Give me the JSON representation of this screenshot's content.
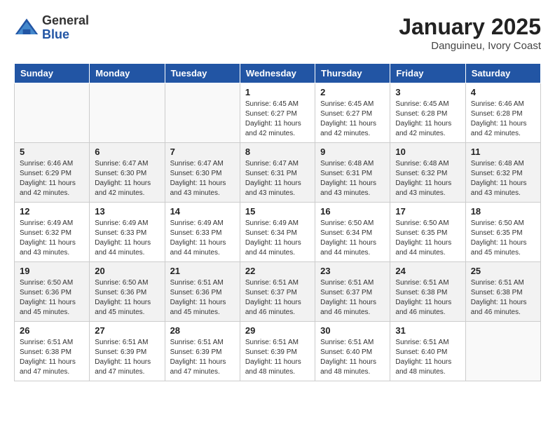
{
  "logo": {
    "general": "General",
    "blue": "Blue"
  },
  "title": "January 2025",
  "location": "Danguineu, Ivory Coast",
  "weekdays": [
    "Sunday",
    "Monday",
    "Tuesday",
    "Wednesday",
    "Thursday",
    "Friday",
    "Saturday"
  ],
  "weeks": [
    [
      {
        "day": "",
        "info": ""
      },
      {
        "day": "",
        "info": ""
      },
      {
        "day": "",
        "info": ""
      },
      {
        "day": "1",
        "info": "Sunrise: 6:45 AM\nSunset: 6:27 PM\nDaylight: 11 hours and 42 minutes."
      },
      {
        "day": "2",
        "info": "Sunrise: 6:45 AM\nSunset: 6:27 PM\nDaylight: 11 hours and 42 minutes."
      },
      {
        "day": "3",
        "info": "Sunrise: 6:45 AM\nSunset: 6:28 PM\nDaylight: 11 hours and 42 minutes."
      },
      {
        "day": "4",
        "info": "Sunrise: 6:46 AM\nSunset: 6:28 PM\nDaylight: 11 hours and 42 minutes."
      }
    ],
    [
      {
        "day": "5",
        "info": "Sunrise: 6:46 AM\nSunset: 6:29 PM\nDaylight: 11 hours and 42 minutes."
      },
      {
        "day": "6",
        "info": "Sunrise: 6:47 AM\nSunset: 6:30 PM\nDaylight: 11 hours and 42 minutes."
      },
      {
        "day": "7",
        "info": "Sunrise: 6:47 AM\nSunset: 6:30 PM\nDaylight: 11 hours and 43 minutes."
      },
      {
        "day": "8",
        "info": "Sunrise: 6:47 AM\nSunset: 6:31 PM\nDaylight: 11 hours and 43 minutes."
      },
      {
        "day": "9",
        "info": "Sunrise: 6:48 AM\nSunset: 6:31 PM\nDaylight: 11 hours and 43 minutes."
      },
      {
        "day": "10",
        "info": "Sunrise: 6:48 AM\nSunset: 6:32 PM\nDaylight: 11 hours and 43 minutes."
      },
      {
        "day": "11",
        "info": "Sunrise: 6:48 AM\nSunset: 6:32 PM\nDaylight: 11 hours and 43 minutes."
      }
    ],
    [
      {
        "day": "12",
        "info": "Sunrise: 6:49 AM\nSunset: 6:32 PM\nDaylight: 11 hours and 43 minutes."
      },
      {
        "day": "13",
        "info": "Sunrise: 6:49 AM\nSunset: 6:33 PM\nDaylight: 11 hours and 44 minutes."
      },
      {
        "day": "14",
        "info": "Sunrise: 6:49 AM\nSunset: 6:33 PM\nDaylight: 11 hours and 44 minutes."
      },
      {
        "day": "15",
        "info": "Sunrise: 6:49 AM\nSunset: 6:34 PM\nDaylight: 11 hours and 44 minutes."
      },
      {
        "day": "16",
        "info": "Sunrise: 6:50 AM\nSunset: 6:34 PM\nDaylight: 11 hours and 44 minutes."
      },
      {
        "day": "17",
        "info": "Sunrise: 6:50 AM\nSunset: 6:35 PM\nDaylight: 11 hours and 44 minutes."
      },
      {
        "day": "18",
        "info": "Sunrise: 6:50 AM\nSunset: 6:35 PM\nDaylight: 11 hours and 45 minutes."
      }
    ],
    [
      {
        "day": "19",
        "info": "Sunrise: 6:50 AM\nSunset: 6:36 PM\nDaylight: 11 hours and 45 minutes."
      },
      {
        "day": "20",
        "info": "Sunrise: 6:50 AM\nSunset: 6:36 PM\nDaylight: 11 hours and 45 minutes."
      },
      {
        "day": "21",
        "info": "Sunrise: 6:51 AM\nSunset: 6:36 PM\nDaylight: 11 hours and 45 minutes."
      },
      {
        "day": "22",
        "info": "Sunrise: 6:51 AM\nSunset: 6:37 PM\nDaylight: 11 hours and 46 minutes."
      },
      {
        "day": "23",
        "info": "Sunrise: 6:51 AM\nSunset: 6:37 PM\nDaylight: 11 hours and 46 minutes."
      },
      {
        "day": "24",
        "info": "Sunrise: 6:51 AM\nSunset: 6:38 PM\nDaylight: 11 hours and 46 minutes."
      },
      {
        "day": "25",
        "info": "Sunrise: 6:51 AM\nSunset: 6:38 PM\nDaylight: 11 hours and 46 minutes."
      }
    ],
    [
      {
        "day": "26",
        "info": "Sunrise: 6:51 AM\nSunset: 6:38 PM\nDaylight: 11 hours and 47 minutes."
      },
      {
        "day": "27",
        "info": "Sunrise: 6:51 AM\nSunset: 6:39 PM\nDaylight: 11 hours and 47 minutes."
      },
      {
        "day": "28",
        "info": "Sunrise: 6:51 AM\nSunset: 6:39 PM\nDaylight: 11 hours and 47 minutes."
      },
      {
        "day": "29",
        "info": "Sunrise: 6:51 AM\nSunset: 6:39 PM\nDaylight: 11 hours and 48 minutes."
      },
      {
        "day": "30",
        "info": "Sunrise: 6:51 AM\nSunset: 6:40 PM\nDaylight: 11 hours and 48 minutes."
      },
      {
        "day": "31",
        "info": "Sunrise: 6:51 AM\nSunset: 6:40 PM\nDaylight: 11 hours and 48 minutes."
      },
      {
        "day": "",
        "info": ""
      }
    ]
  ]
}
